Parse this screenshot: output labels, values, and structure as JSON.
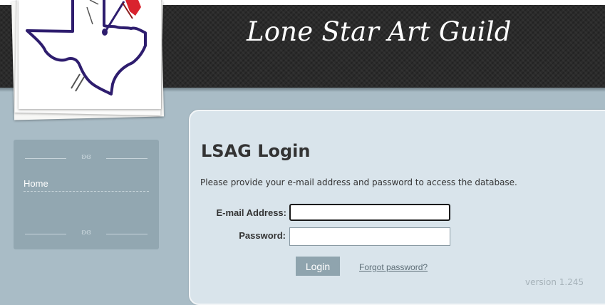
{
  "site": {
    "title": "Lone Star Art Guild"
  },
  "logo": {
    "icon": "texas-map-palette-icon"
  },
  "sidebar": {
    "ornament": "ʚɞ",
    "items": [
      {
        "label": "Home"
      }
    ]
  },
  "login": {
    "title": "LSAG Login",
    "intro": "Please provide your e-mail address and password to access the database.",
    "email_label": "E-mail Address:",
    "email_value": "",
    "password_label": "Password:",
    "password_value": "",
    "login_button": "Login",
    "forgot_link": "Forgot password?"
  },
  "footer": {
    "version": "version 1.245"
  },
  "colors": {
    "header_bg": "#2b2b2b",
    "page_bg": "#a9bcc6",
    "panel_bg": "#d9e4eb",
    "sidebar_bg": "#92a7b1",
    "button_bg": "#8fa4ae",
    "flag_red": "#d9232e",
    "outline_purple": "#2e1d6e"
  }
}
